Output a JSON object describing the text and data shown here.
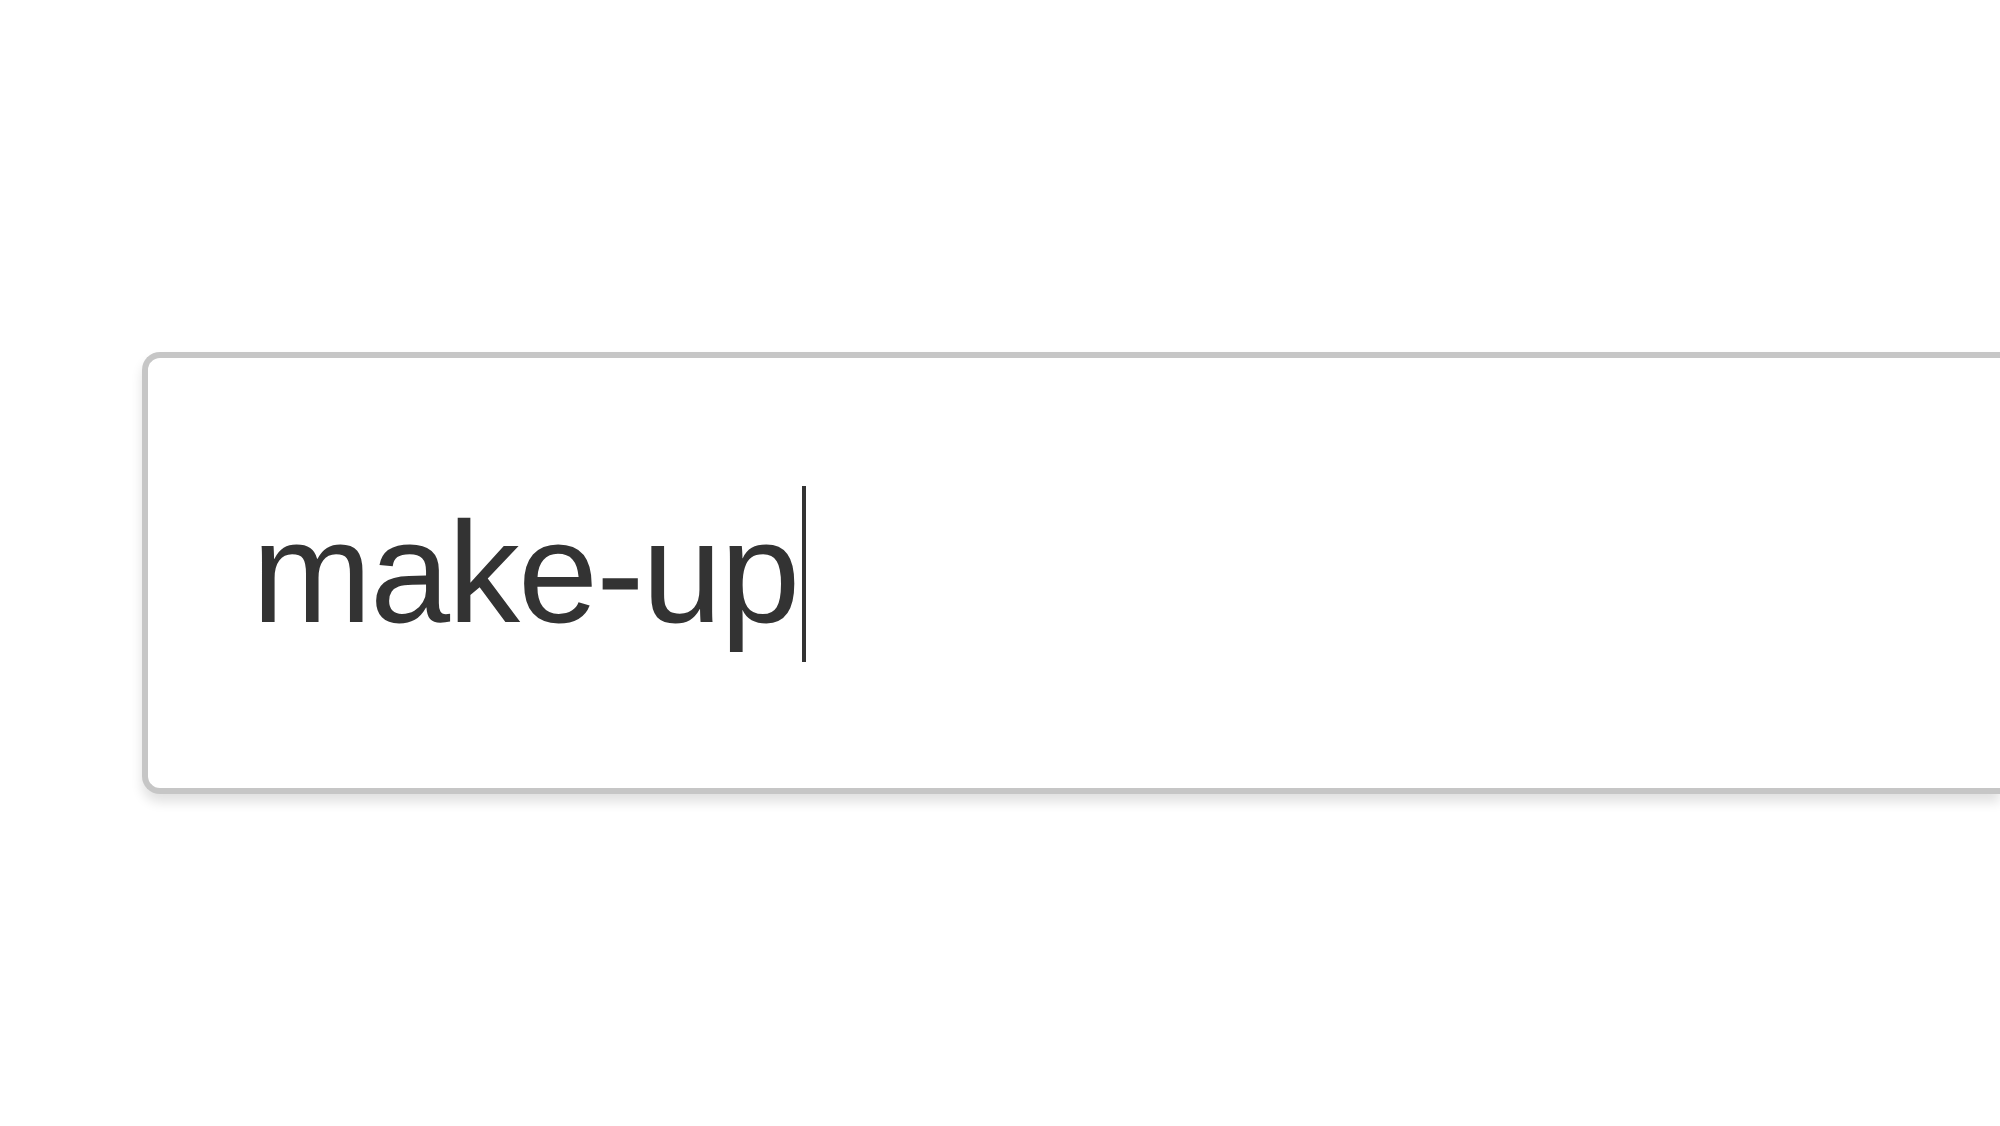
{
  "search_field": {
    "value": "make-up",
    "focused": true
  }
}
